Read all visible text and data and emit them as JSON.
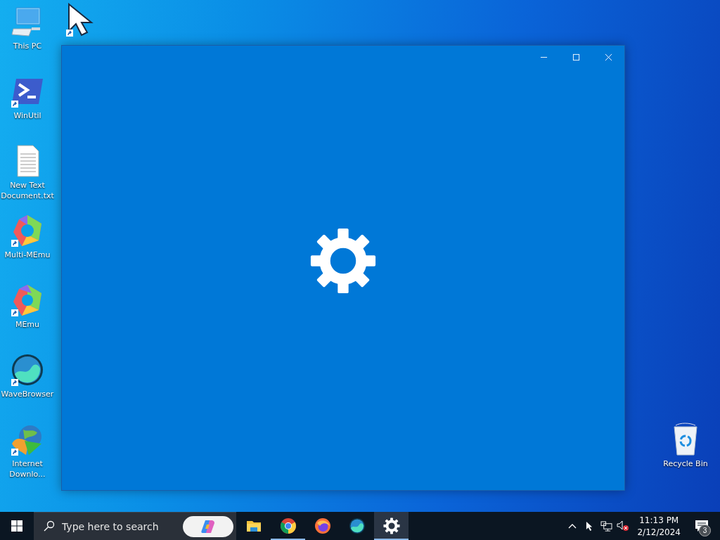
{
  "desktop_icons": [
    {
      "label": "This PC",
      "kind": "pc",
      "shortcut": false
    },
    {
      "label": "WinUtil",
      "kind": "terminal",
      "shortcut": true
    },
    {
      "label": "New Text Document.txt",
      "kind": "text",
      "shortcut": false
    },
    {
      "label": "Multi-MEmu",
      "kind": "ring",
      "shortcut": true
    },
    {
      "label": "MEmu",
      "kind": "ring2",
      "shortcut": true
    },
    {
      "label": "WaveBrowser",
      "kind": "wave",
      "shortcut": true
    },
    {
      "label": "Internet Downlo...",
      "kind": "idm",
      "shortcut": true
    }
  ],
  "hidden_icon": {
    "kind": "cursor",
    "shortcut": true
  },
  "recycle_bin": {
    "label": "Recycle Bin"
  },
  "window": {
    "loading": true
  },
  "taskbar": {
    "search": {
      "placeholder": "Type here to search"
    },
    "apps": [
      {
        "kind": "explorer",
        "running": false,
        "selected": false
      },
      {
        "kind": "chrome",
        "running": true,
        "selected": false
      },
      {
        "kind": "firefox",
        "running": false,
        "selected": false
      },
      {
        "kind": "wave",
        "running": false,
        "selected": false
      },
      {
        "kind": "settings",
        "running": true,
        "selected": true
      }
    ],
    "tray": {
      "volume_muted": true
    },
    "clock": {
      "time": "11:13 PM",
      "date": "2/12/2024"
    },
    "notifications": {
      "count": "3"
    }
  }
}
